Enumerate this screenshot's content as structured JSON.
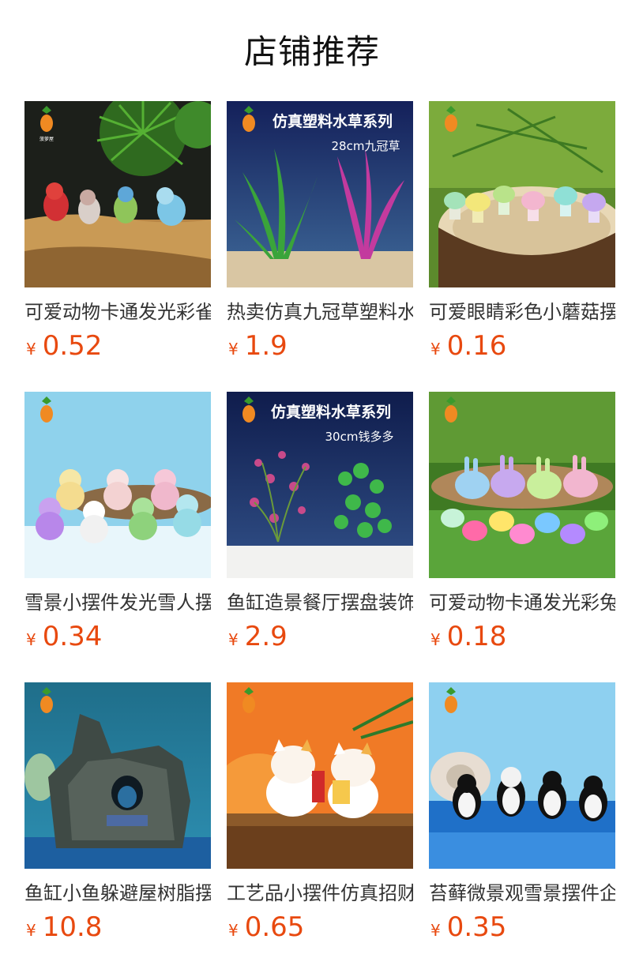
{
  "section_title": "店铺推荐",
  "currency_symbol": "¥",
  "products": [
    {
      "name": "可爱动物卡通发光彩雀",
      "price": "0.52",
      "icon": "glowing-birds-image",
      "banner": {
        "line1": "",
        "line2": ""
      }
    },
    {
      "name": "热卖仿真九冠草塑料水草",
      "price": "1.9",
      "icon": "plastic-plant-image",
      "banner": {
        "line1": "仿真塑料水草系列",
        "line2": "28cm九冠草"
      }
    },
    {
      "name": "可爱眼睛彩色小蘑菇摆件",
      "price": "0.16",
      "icon": "mushroom-image",
      "banner": {
        "line1": "",
        "line2": ""
      }
    },
    {
      "name": "雪景小摆件发光雪人摆件",
      "price": "0.34",
      "icon": "snowman-image",
      "banner": {
        "line1": "",
        "line2": ""
      }
    },
    {
      "name": "鱼缸造景餐厅摆盘装饰",
      "price": "2.9",
      "icon": "plastic-plant-image",
      "banner": {
        "line1": "仿真塑料水草系列",
        "line2": "30cm钱多多"
      }
    },
    {
      "name": "可爱动物卡通发光彩兔",
      "price": "0.18",
      "icon": "glowing-rabbits-image",
      "banner": {
        "line1": "",
        "line2": ""
      }
    },
    {
      "name": "鱼缸小鱼躲避屋树脂摆件",
      "price": "10.8",
      "icon": "tree-stump-hideout-image",
      "banner": {
        "line1": "",
        "line2": ""
      }
    },
    {
      "name": "工艺品小摆件仿真招财猫",
      "price": "0.65",
      "icon": "lucky-cat-image",
      "banner": {
        "line1": "",
        "line2": ""
      }
    },
    {
      "name": "苔藓微景观雪景摆件企鹅",
      "price": "0.35",
      "icon": "penguins-image",
      "banner": {
        "line1": "",
        "line2": ""
      }
    }
  ],
  "colors": {
    "price": "#e8490f",
    "title": "#111111",
    "name": "#333333"
  }
}
